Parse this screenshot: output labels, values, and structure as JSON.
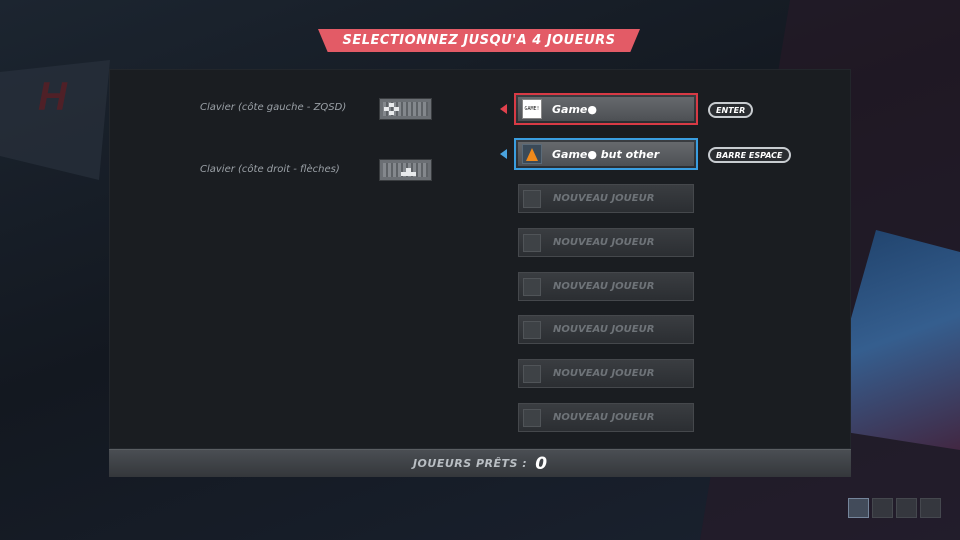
{
  "title": "SELECTIONNEZ JUSQU'A 4 JOUEURS",
  "devices": [
    {
      "label": "Clavier (côte gauche - ZQSD)",
      "icon": "keyboard-icon"
    },
    {
      "label": "Clavier (côte droit - flèches)",
      "icon": "keyboard-icon"
    }
  ],
  "slots": [
    {
      "name": "Game●",
      "key": "ENTER",
      "state": "active",
      "color": "#d83a45",
      "avatar": "GAME! logo"
    },
    {
      "name": "Game● but other",
      "key": "BARRE ESPACE",
      "state": "active",
      "color": "#3a9ee0",
      "avatar": "traffic-cone-icon"
    },
    {
      "name": "NOUVEAU JOUEUR",
      "state": "empty"
    },
    {
      "name": "NOUVEAU JOUEUR",
      "state": "empty"
    },
    {
      "name": "NOUVEAU JOUEUR",
      "state": "empty"
    },
    {
      "name": "NOUVEAU JOUEUR",
      "state": "empty"
    },
    {
      "name": "NOUVEAU JOUEUR",
      "state": "empty"
    },
    {
      "name": "NOUVEAU JOUEUR",
      "state": "empty"
    }
  ],
  "avatar_text": "GAME!",
  "footer": {
    "label": "JOUEURS PRÊTS :",
    "count": "0"
  },
  "colors": {
    "accent": "#e35b66",
    "player1": "#d83a45",
    "player2": "#3a9ee0"
  }
}
